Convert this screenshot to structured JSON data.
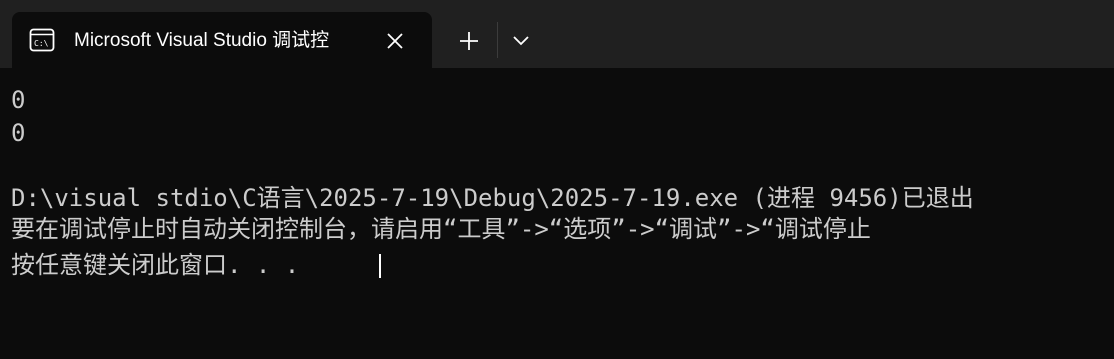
{
  "tab": {
    "icon": "console-icon",
    "title": "Microsoft Visual Studio 调试控"
  },
  "controls": {
    "close_icon": "close-icon",
    "new_tab_icon": "plus-icon",
    "dropdown_icon": "chevron-down-icon"
  },
  "console": {
    "lines": [
      "0",
      "0",
      "",
      "D:\\visual stdio\\C语言\\2025-7-19\\Debug\\2025-7-19.exe (进程 9456)已退出",
      "要在调试停止时自动关闭控制台，请启用“工具”->“选项”->“调试”->“调试停止",
      "按任意键关闭此窗口. . ."
    ]
  },
  "colors": {
    "background": "#0c0c0c",
    "tabbar": "#202020",
    "text": "#cccccc"
  }
}
